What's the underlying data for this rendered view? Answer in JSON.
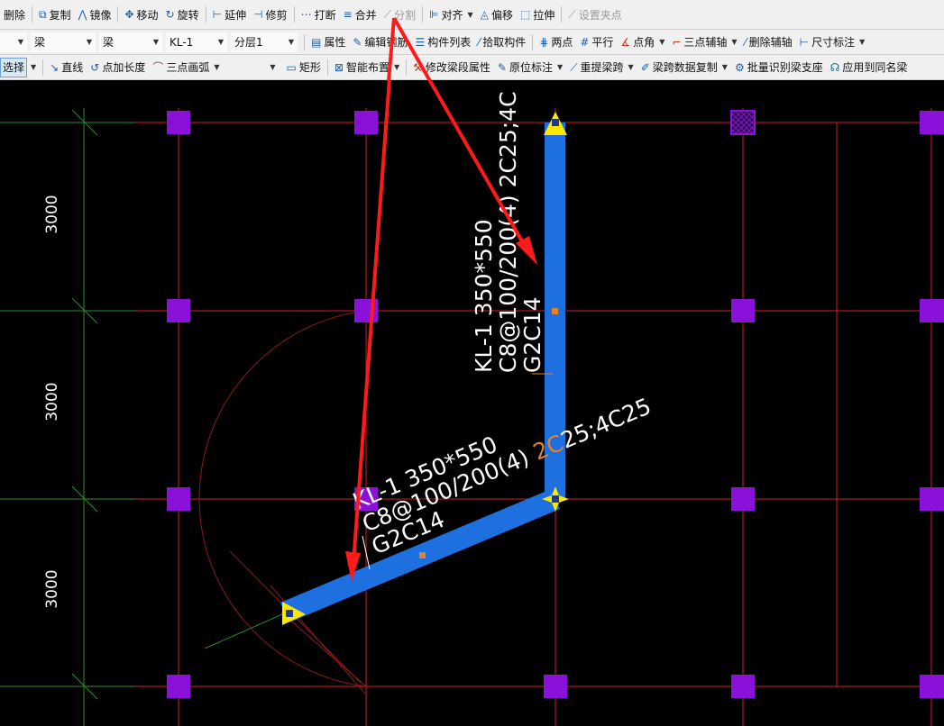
{
  "toolbar1": {
    "delete": "删除",
    "copy": "复制",
    "mirror": "镜像",
    "move": "移动",
    "rotate": "旋转",
    "extend": "延伸",
    "trim": "修剪",
    "break": "打断",
    "merge": "合并",
    "split": "分割",
    "align": "对齐",
    "offset": "偏移",
    "stretch": "拉伸",
    "set_grip": "设置夹点"
  },
  "toolbar2": {
    "combo1": "",
    "combo2": "梁",
    "combo3": "梁",
    "combo4": "KL-1",
    "combo5": "分层1",
    "properties": "属性",
    "edit_rebar": "编辑钢筋",
    "component_list": "构件列表",
    "pick_component": "拾取构件",
    "two_points": "两点",
    "parallel": "平行",
    "point_angle": "点角",
    "three_point_axis": "三点辅轴",
    "delete_axis": "删除辅轴",
    "dimension": "尺寸标注"
  },
  "toolbar3": {
    "select": "选择",
    "line": "直线",
    "point_length": "点加长度",
    "three_point_arc": "三点画弧",
    "rect_combo": "",
    "rectangle": "矩形",
    "smart_layout": "智能布置",
    "modify_span_props": "修改梁段属性",
    "in_situ_label": "原位标注",
    "re_extract_span": "重提梁跨",
    "copy_span_data": "梁跨数据复制",
    "batch_identify": "批量识别梁支座",
    "apply_same_name": "应用到同名梁"
  },
  "canvas": {
    "dimensions": [
      "3000",
      "3000",
      "3000"
    ],
    "beam_vertical": {
      "line1": "KL-1 350*550",
      "line2": "C8@100/200(4) 2C25;4C",
      "line3": "G2C14"
    },
    "beam_diagonal": {
      "line1": "KL-1 350*550",
      "line2_a": "C8@100/200(4) ",
      "line2_b": "2C",
      "line2_c": "25;4C25",
      "line3": "G2C14"
    },
    "colors": {
      "background": "#000000",
      "axis_red": "#d21e1e",
      "aux_green": "#2e8b2e",
      "column": "#8a12d8",
      "beam": "#1e6fe0",
      "text": "#ffffff",
      "highlight_text": "#e8802a",
      "grip": "#ffe800",
      "annotation_arrow": "#ff1a1a"
    }
  }
}
